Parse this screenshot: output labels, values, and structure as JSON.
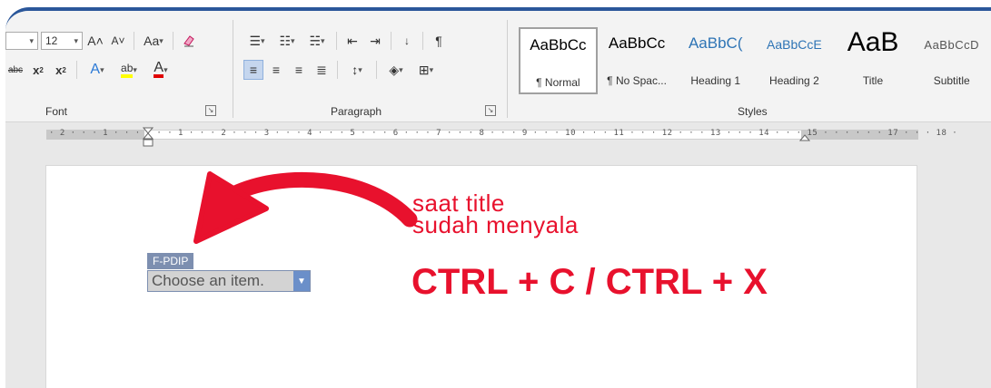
{
  "ribbon": {
    "font": {
      "size_value": "12",
      "label": "Font",
      "change_case_label": "Aa",
      "grow_font_label": "A˄",
      "shrink_font_label": "A˅"
    },
    "paragraph": {
      "label": "Paragraph"
    },
    "styles": {
      "label": "Styles",
      "items": [
        {
          "sample": "AaBbCc",
          "name": "¶ Normal"
        },
        {
          "sample": "AaBbCc",
          "name": "¶ No Spac..."
        },
        {
          "sample": "AaBbC(",
          "name": "Heading 1"
        },
        {
          "sample": "AaBbCcE",
          "name": "Heading 2"
        },
        {
          "sample": "AaB",
          "name": "Title"
        },
        {
          "sample": "AaBbCcD",
          "name": "Subtitle"
        }
      ]
    }
  },
  "ruler": {
    "text": "· 2 · · · 1 · · ·      · · · 1 · · · 2 · · · 3 · · · 4 · · · 5 · · · 6 · · · 7 · · · 8 · · · 9 · · · 10 · · · 11 · · · 12 · · · 13 · · · 14 · · · 15 · · ·      · · · 17 · · · 18 ·"
  },
  "document": {
    "content_control": {
      "title": "F-PDIP",
      "placeholder": "Choose an item."
    }
  },
  "annotation": {
    "note_line1": "saat title",
    "note_line2": "sudah menyala",
    "hotkeys": "CTRL + C / CTRL + X",
    "color": "#e8112d"
  },
  "colors": {
    "accent": "#2b579a",
    "content_control": "#7d8fb0"
  }
}
